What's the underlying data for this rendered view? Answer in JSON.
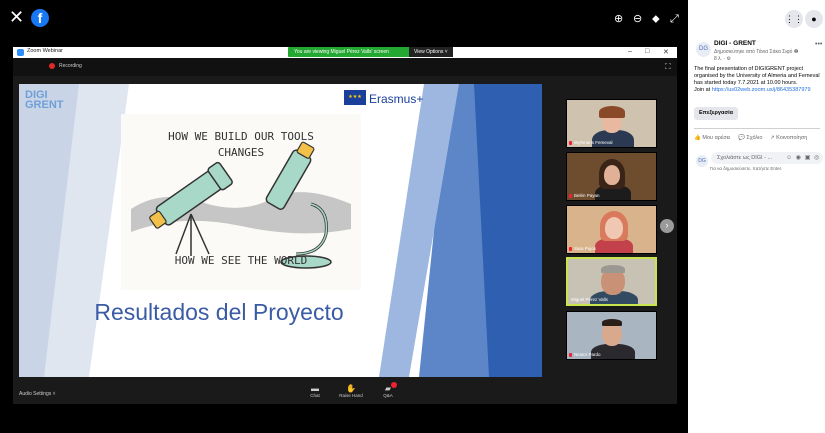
{
  "viewer": {
    "close_icon": "✕",
    "facebook_logo": "f",
    "zoom_in_icon": "⊕",
    "zoom_out_icon": "⊖",
    "tag_icon": "⬥",
    "expand_icon": "⤢"
  },
  "zoom": {
    "window_title": "Zoom Webinar",
    "viewing_banner": "You are viewing Miguel Pérez Valls' screen",
    "view_options": "View Options ˅",
    "recording_label": "Recording",
    "controls": {
      "audio_settings": "Audio Settings ˄",
      "chat": "Chat",
      "raise_hand": "Raise Hand",
      "qa": "Q&A"
    }
  },
  "slide": {
    "logo_text_top": "DIGI",
    "logo_text_bottom": "GRENT",
    "erasmus": "Erasmus+",
    "sketch_top_line1": "HOW WE BUILD OUR TOOLS",
    "sketch_top_line2": "CHANGES",
    "sketch_bottom": "HOW WE SEE THE WORLD",
    "title": "Resultados del Proyecto"
  },
  "participants": [
    {
      "name": "Wyhmaris Femeval"
    },
    {
      "name": "Belén Payan"
    },
    {
      "name": "Sara Pujos"
    },
    {
      "name": "Miguel Pérez Valls"
    },
    {
      "name": "Nestor Pardo"
    }
  ],
  "sidebar": {
    "page_name": "DIGI - GRENT",
    "page_sub": "Δημοσιεύτηκε από Τάνια Σάκα Σιφό ❷",
    "page_time": "8 λ. · ⚙",
    "post_text_1": "The final presentation of DIGIGRENT project organised by the University of Almeria and Femeval has started today 7.7.2021 at 10.00 hours.",
    "post_text_2": "Join at ",
    "post_link": "https://us02web.zoom.us/j/86435387979",
    "edit_button": "Επεξεργασία",
    "actions": [
      "Μου αρέσει",
      "Σχόλιο",
      "Κοινοποίηση"
    ],
    "comment_placeholder": "Σχολιάστε ως DIGI - ...",
    "comment_hint": "Για να δημοσιεύσετε, πατήστε Enter."
  }
}
